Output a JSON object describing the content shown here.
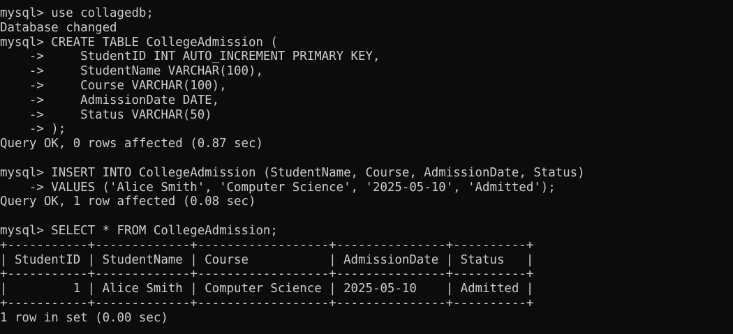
{
  "terminal": {
    "lines": [
      "mysql> use collagedb;",
      "Database changed",
      "mysql> CREATE TABLE CollegeAdmission (",
      "    ->     StudentID INT AUTO_INCREMENT PRIMARY KEY,",
      "    ->     StudentName VARCHAR(100),",
      "    ->     Course VARCHAR(100),",
      "    ->     AdmissionDate DATE,",
      "    ->     Status VARCHAR(50)",
      "    -> );",
      "Query OK, 0 rows affected (0.87 sec)",
      "",
      "mysql> INSERT INTO CollegeAdmission (StudentName, Course, AdmissionDate, Status)",
      "    -> VALUES ('Alice Smith', 'Computer Science', '2025-05-10', 'Admitted');",
      "Query OK, 1 row affected (0.08 sec)",
      "",
      "mysql> SELECT * FROM CollegeAdmission;",
      "+-----------+-------------+------------------+---------------+----------+",
      "| StudentID | StudentName | Course           | AdmissionDate | Status   |",
      "+-----------+-------------+------------------+---------------+----------+",
      "|         1 | Alice Smith | Computer Science | 2025-05-10    | Admitted |",
      "+-----------+-------------+------------------+---------------+----------+",
      "1 row in set (0.00 sec)"
    ]
  }
}
